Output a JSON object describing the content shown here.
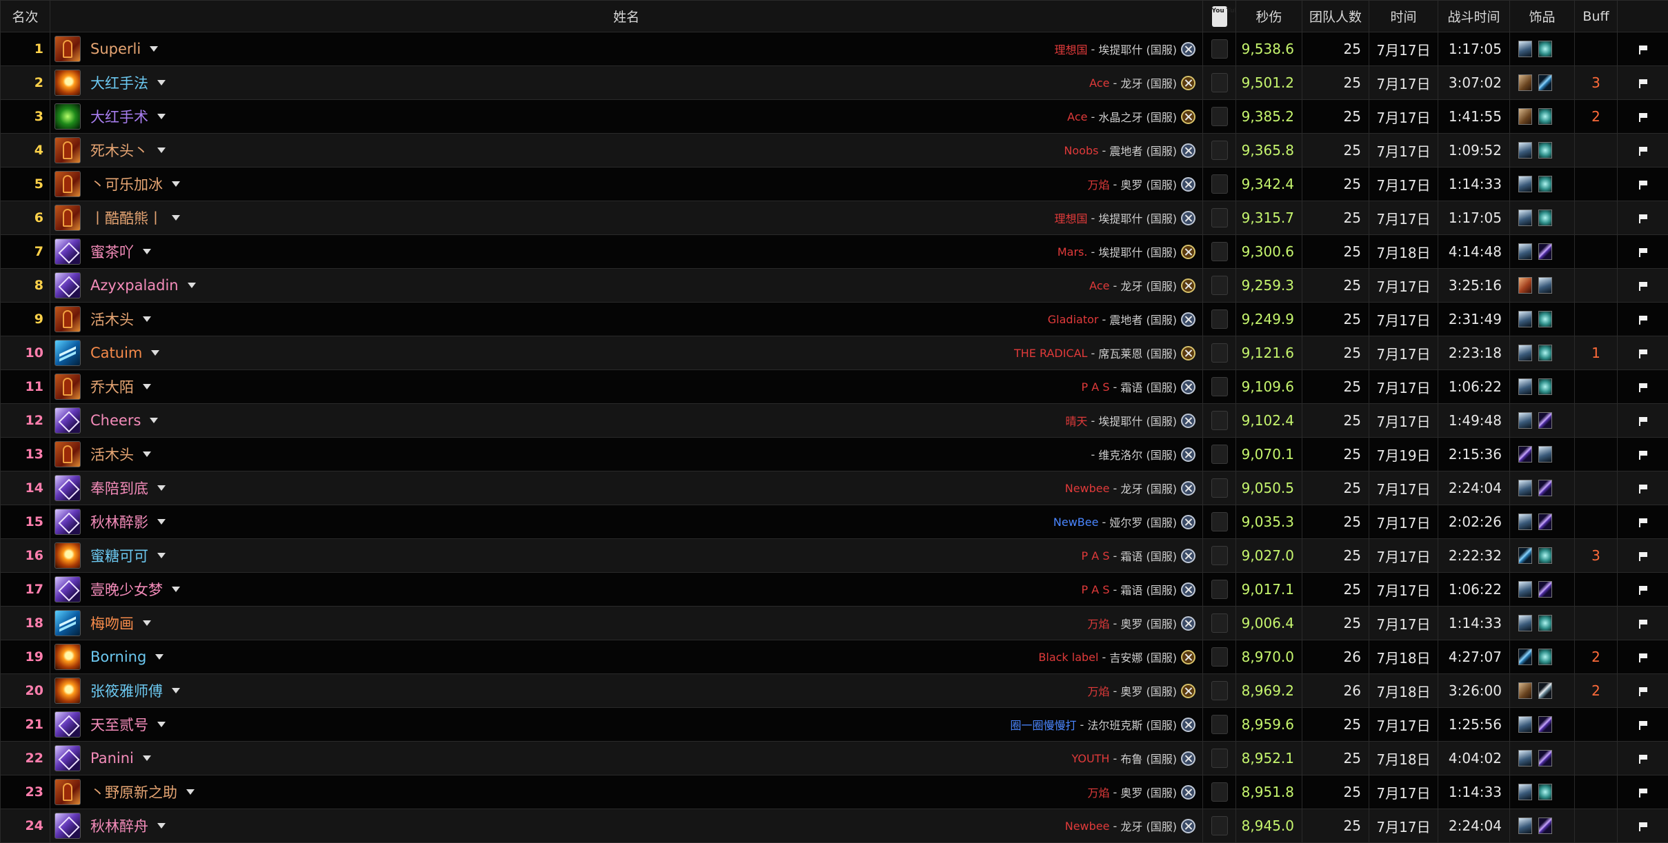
{
  "colors": {
    "rank": "#ffd24a",
    "rank_alt": "#ff7fae",
    "class_warrior": "#e6a573",
    "class_mage": "#6cc8f0",
    "class_paladin": "#f48cba",
    "class_shaman": "#f58a4a",
    "class_druid": "#a87ef0",
    "dps": "#c6f56e",
    "buff": "#ff6b3a"
  },
  "header": {
    "rank": "名次",
    "name": "姓名",
    "youtube": "You Tube",
    "dps": "秒伤",
    "raid_size": "团队人数",
    "date": "时间",
    "duration": "战斗时间",
    "trinkets": "饰品",
    "buff": "Buff"
  },
  "rows": [
    {
      "rank": "1",
      "name": "Superli",
      "cls": "warrior",
      "guild": "理想国",
      "guild_color": "#e03a3a",
      "realm": "埃提耶什 (国服)",
      "faction": "alliance",
      "dps": "9,538.6",
      "size": "25",
      "date": "7月17日",
      "duration": "1:17:05",
      "trinkets": [
        "skull",
        "orb"
      ],
      "buff": ""
    },
    {
      "rank": "2",
      "name": "大红手法",
      "cls": "mage",
      "guild": "Ace",
      "guild_color": "#e03a3a",
      "realm": "龙牙 (国服)",
      "faction": "horde",
      "dps": "9,501.2",
      "size": "25",
      "date": "7月17日",
      "duration": "3:07:02",
      "trinkets": [
        "beast",
        "blade"
      ],
      "buff": "3"
    },
    {
      "rank": "3",
      "name": "大红手术",
      "cls": "druid",
      "guild": "Ace",
      "guild_color": "#e03a3a",
      "realm": "水晶之牙 (国服)",
      "faction": "horde",
      "dps": "9,385.2",
      "size": "25",
      "date": "7月17日",
      "duration": "1:41:55",
      "trinkets": [
        "beast",
        "orb"
      ],
      "buff": "2"
    },
    {
      "rank": "4",
      "name": "死木头丶",
      "cls": "warrior",
      "guild": "Noobs",
      "guild_color": "#e03a3a",
      "realm": "震地者 (国服)",
      "faction": "alliance",
      "dps": "9,365.8",
      "size": "25",
      "date": "7月17日",
      "duration": "1:09:52",
      "trinkets": [
        "skull",
        "orb"
      ],
      "buff": ""
    },
    {
      "rank": "5",
      "name": "丶可乐加冰",
      "cls": "warrior",
      "guild": "万焰",
      "guild_color": "#e03a3a",
      "realm": "奥罗 (国服)",
      "faction": "alliance",
      "dps": "9,342.4",
      "size": "25",
      "date": "7月17日",
      "duration": "1:14:33",
      "trinkets": [
        "skull",
        "orb"
      ],
      "buff": ""
    },
    {
      "rank": "6",
      "name": "丨酷酷熊丨",
      "cls": "warrior",
      "guild": "理想国",
      "guild_color": "#e03a3a",
      "realm": "埃提耶什 (国服)",
      "faction": "alliance",
      "dps": "9,315.7",
      "size": "25",
      "date": "7月17日",
      "duration": "1:17:05",
      "trinkets": [
        "skull",
        "orb"
      ],
      "buff": ""
    },
    {
      "rank": "7",
      "name": "蜜茶吖",
      "cls": "paladin",
      "guild": "Mars.",
      "guild_color": "#e03a3a",
      "realm": "埃提耶什 (国服)",
      "faction": "horde",
      "dps": "9,300.6",
      "size": "25",
      "date": "7月18日",
      "duration": "4:14:48",
      "trinkets": [
        "skull",
        "rod"
      ],
      "buff": ""
    },
    {
      "rank": "8",
      "name": "Azyxpaladin",
      "cls": "paladin",
      "guild": "Ace",
      "guild_color": "#e03a3a",
      "realm": "龙牙 (国服)",
      "faction": "horde",
      "dps": "9,259.3",
      "size": "25",
      "date": "7月17日",
      "duration": "3:25:16",
      "trinkets": [
        "claw",
        "skull"
      ],
      "buff": ""
    },
    {
      "rank": "9",
      "name": "活木头",
      "cls": "warrior",
      "guild": "Gladiator",
      "guild_color": "#e03a3a",
      "realm": "震地者 (国服)",
      "faction": "alliance",
      "dps": "9,249.9",
      "size": "25",
      "date": "7月17日",
      "duration": "2:31:49",
      "trinkets": [
        "skull",
        "orb"
      ],
      "buff": ""
    },
    {
      "rank": "10",
      "name": "Catuim",
      "cls": "shaman",
      "guild": "THE RADICAL",
      "guild_color": "#e03a3a",
      "realm": "席瓦莱恩 (国服)",
      "faction": "horde",
      "dps": "9,121.6",
      "size": "25",
      "date": "7月17日",
      "duration": "2:23:18",
      "trinkets": [
        "skull",
        "orb"
      ],
      "buff": "1"
    },
    {
      "rank": "11",
      "name": "乔大陌",
      "cls": "warrior",
      "guild": "P A S",
      "guild_color": "#e03a3a",
      "realm": "霜语 (国服)",
      "faction": "alliance",
      "dps": "9,109.6",
      "size": "25",
      "date": "7月17日",
      "duration": "1:06:22",
      "trinkets": [
        "skull",
        "orb"
      ],
      "buff": ""
    },
    {
      "rank": "12",
      "name": "Cheers",
      "cls": "paladin",
      "guild": "晴天",
      "guild_color": "#e03a3a",
      "realm": "埃提耶什 (国服)",
      "faction": "alliance",
      "dps": "9,102.4",
      "size": "25",
      "date": "7月17日",
      "duration": "1:49:48",
      "trinkets": [
        "skull",
        "rod"
      ],
      "buff": ""
    },
    {
      "rank": "13",
      "name": "活木头",
      "cls": "warrior",
      "guild": "",
      "guild_color": "#e03a3a",
      "realm": "维克洛尔 (国服)",
      "faction": "alliance",
      "dps": "9,070.1",
      "size": "25",
      "date": "7月19日",
      "duration": "2:15:36",
      "trinkets": [
        "rod",
        "skull"
      ],
      "buff": ""
    },
    {
      "rank": "14",
      "name": "奉陪到底",
      "cls": "paladin",
      "guild": "Newbee",
      "guild_color": "#e03a3a",
      "realm": "龙牙 (国服)",
      "faction": "alliance",
      "dps": "9,050.5",
      "size": "25",
      "date": "7月17日",
      "duration": "2:24:04",
      "trinkets": [
        "skull",
        "rod"
      ],
      "buff": ""
    },
    {
      "rank": "15",
      "name": "秋林醉影",
      "cls": "paladin",
      "guild": "NewBee",
      "guild_color": "#4a86ff",
      "realm": "娅尔罗 (国服)",
      "faction": "alliance",
      "dps": "9,035.3",
      "size": "25",
      "date": "7月17日",
      "duration": "2:02:26",
      "trinkets": [
        "skull",
        "rod"
      ],
      "buff": ""
    },
    {
      "rank": "16",
      "name": "蜜糖可可",
      "cls": "mage",
      "guild": "P A S",
      "guild_color": "#e03a3a",
      "realm": "霜语 (国服)",
      "faction": "alliance",
      "dps": "9,027.0",
      "size": "25",
      "date": "7月17日",
      "duration": "2:22:32",
      "trinkets": [
        "blade",
        "orb"
      ],
      "buff": "3"
    },
    {
      "rank": "17",
      "name": "壹晚少女梦",
      "cls": "paladin",
      "guild": "P A S",
      "guild_color": "#e03a3a",
      "realm": "霜语 (国服)",
      "faction": "alliance",
      "dps": "9,017.1",
      "size": "25",
      "date": "7月17日",
      "duration": "1:06:22",
      "trinkets": [
        "skull",
        "rod"
      ],
      "buff": ""
    },
    {
      "rank": "18",
      "name": "梅吻画",
      "cls": "shaman",
      "guild": "万焰",
      "guild_color": "#e03a3a",
      "realm": "奥罗 (国服)",
      "faction": "alliance",
      "dps": "9,006.4",
      "size": "25",
      "date": "7月17日",
      "duration": "1:14:33",
      "trinkets": [
        "skull",
        "orb"
      ],
      "buff": ""
    },
    {
      "rank": "19",
      "name": "Borning",
      "cls": "mage",
      "guild": "Black label",
      "guild_color": "#e03a3a",
      "realm": "吉安娜 (国服)",
      "faction": "horde",
      "dps": "8,970.0",
      "size": "26",
      "date": "7月18日",
      "duration": "4:27:07",
      "trinkets": [
        "blade",
        "orb"
      ],
      "buff": "2"
    },
    {
      "rank": "20",
      "name": "张筱雅师傅",
      "cls": "mage",
      "guild": "万焰",
      "guild_color": "#e03a3a",
      "realm": "奥罗 (国服)",
      "faction": "horde",
      "dps": "8,969.2",
      "size": "26",
      "date": "7月18日",
      "duration": "3:26:00",
      "trinkets": [
        "beast",
        "dagger"
      ],
      "buff": "2"
    },
    {
      "rank": "21",
      "name": "天至贰号",
      "cls": "paladin",
      "guild": "圈一圈慢慢打",
      "guild_color": "#4a86ff",
      "realm": "法尔班克斯 (国服)",
      "faction": "alliance",
      "dps": "8,959.6",
      "size": "25",
      "date": "7月17日",
      "duration": "1:25:56",
      "trinkets": [
        "skull",
        "rod"
      ],
      "buff": ""
    },
    {
      "rank": "22",
      "name": "Panini",
      "cls": "paladin",
      "guild": "YOUTH",
      "guild_color": "#e03a3a",
      "realm": "布鲁 (国服)",
      "faction": "alliance",
      "dps": "8,952.1",
      "size": "25",
      "date": "7月18日",
      "duration": "4:04:02",
      "trinkets": [
        "skull",
        "rod"
      ],
      "buff": ""
    },
    {
      "rank": "23",
      "name": "丶野原新之助",
      "cls": "warrior",
      "guild": "万焰",
      "guild_color": "#e03a3a",
      "realm": "奥罗 (国服)",
      "faction": "alliance",
      "dps": "8,951.8",
      "size": "25",
      "date": "7月17日",
      "duration": "1:14:33",
      "trinkets": [
        "skull",
        "orb"
      ],
      "buff": ""
    },
    {
      "rank": "24",
      "name": "秋林醉舟",
      "cls": "paladin",
      "guild": "Newbee",
      "guild_color": "#e03a3a",
      "realm": "龙牙 (国服)",
      "faction": "alliance",
      "dps": "8,945.0",
      "size": "25",
      "date": "7月17日",
      "duration": "2:24:04",
      "trinkets": [
        "skull",
        "rod"
      ],
      "buff": ""
    }
  ]
}
